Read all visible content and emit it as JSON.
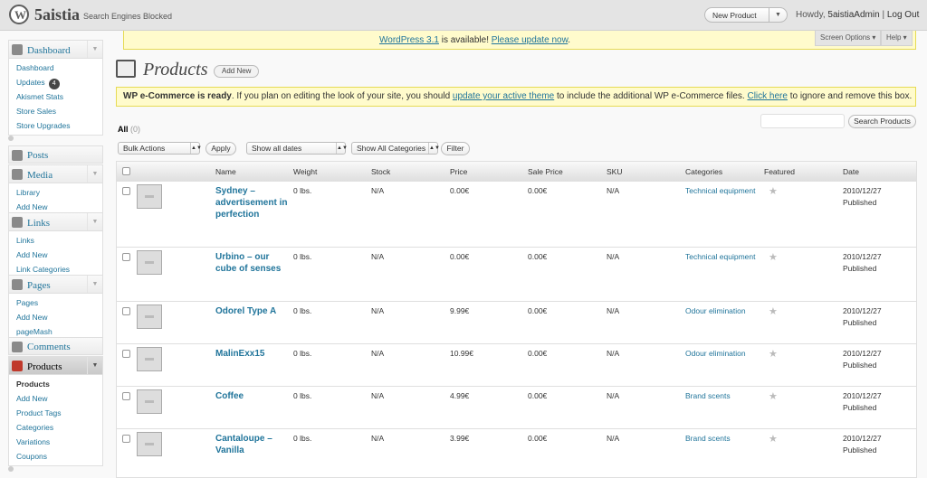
{
  "header": {
    "site_title": "5aistia",
    "site_status": "Search Engines Blocked",
    "favorite_action": "New Product",
    "howdy_prefix": "Howdy,",
    "user": "5aistiaAdmin",
    "separator": "|",
    "logout": "Log Out",
    "screen_options": "Screen Options ▾",
    "help": "Help ▾"
  },
  "update_nag": {
    "link_version": "WordPress 3.1",
    "middle": " is available! ",
    "link_update": "Please update now",
    "end": "."
  },
  "menu": {
    "dashboard": {
      "label": "Dashboard",
      "items": [
        "Dashboard",
        "Updates",
        "Akismet Stats",
        "Store Sales",
        "Store Upgrades"
      ],
      "updates_count": "4"
    },
    "posts": "Posts",
    "media": {
      "label": "Media",
      "items": [
        "Library",
        "Add New"
      ]
    },
    "links": {
      "label": "Links",
      "items": [
        "Links",
        "Add New",
        "Link Categories"
      ]
    },
    "pages": {
      "label": "Pages",
      "items": [
        "Pages",
        "Add New",
        "pageMash"
      ]
    },
    "comments": "Comments",
    "products": {
      "label": "Products",
      "items": [
        "Products",
        "Add New",
        "Product Tags",
        "Categories",
        "Variations",
        "Coupons"
      ]
    }
  },
  "page": {
    "title": "Products",
    "add_new": "Add New"
  },
  "wpsc_notice": {
    "bold": "WP e-Commerce is ready",
    "t1": ". If you plan on editing the look of your site, you should ",
    "link1": "update your active theme",
    "t2": " to include the additional WP e-Commerce files. ",
    "link2": "Click here",
    "t3": " to ignore and remove this box."
  },
  "filters": {
    "all_label": "All",
    "all_count": "(0)",
    "search_button": "Search Products",
    "bulk_actions": "Bulk Actions",
    "apply": "Apply",
    "dates": "Show all dates",
    "categories": "Show All Categories",
    "filter": "Filter"
  },
  "table": {
    "columns": [
      "Name",
      "Weight",
      "Stock",
      "Price",
      "Sale Price",
      "SKU",
      "Categories",
      "Featured",
      "Date"
    ],
    "rows": [
      {
        "name": "Sydney – advertisement in perfection",
        "weight": "0 lbs.",
        "stock": "N/A",
        "price": "0.00€",
        "sale": "0.00€",
        "sku": "N/A",
        "category": "Technical equipment",
        "date": "2010/12/27",
        "status": "Published"
      },
      {
        "name": "Urbino – our cube of senses",
        "weight": "0 lbs.",
        "stock": "N/A",
        "price": "0.00€",
        "sale": "0.00€",
        "sku": "N/A",
        "category": "Technical equipment",
        "date": "2010/12/27",
        "status": "Published"
      },
      {
        "name": "Odorel Type A",
        "weight": "0 lbs.",
        "stock": "N/A",
        "price": "9.99€",
        "sale": "0.00€",
        "sku": "N/A",
        "category": "Odour elimination",
        "date": "2010/12/27",
        "status": "Published"
      },
      {
        "name": "MalinExx15",
        "weight": "0 lbs.",
        "stock": "N/A",
        "price": "10.99€",
        "sale": "0.00€",
        "sku": "N/A",
        "category": "Odour elimination",
        "date": "2010/12/27",
        "status": "Published"
      },
      {
        "name": "Coffee",
        "weight": "0 lbs.",
        "stock": "N/A",
        "price": "4.99€",
        "sale": "0.00€",
        "sku": "N/A",
        "category": "Brand scents",
        "date": "2010/12/27",
        "status": "Published"
      },
      {
        "name": "Cantaloupe – Vanilla",
        "weight": "0 lbs.",
        "stock": "N/A",
        "price": "3.99€",
        "sale": "0.00€",
        "sku": "N/A",
        "category": "Brand scents",
        "date": "2010/12/27",
        "status": "Published"
      }
    ]
  }
}
